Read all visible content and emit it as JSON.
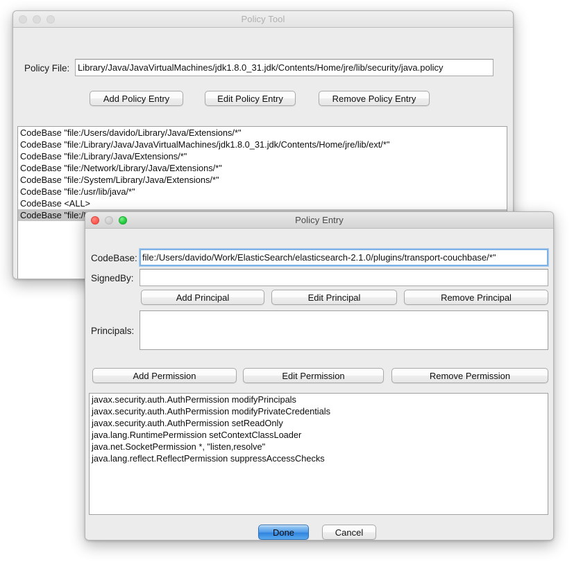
{
  "policy_tool": {
    "title": "Policy Tool",
    "window_state": "inactive",
    "policy_file_label": "Policy File:",
    "policy_file_value": "Library/Java/JavaVirtualMachines/jdk1.8.0_31.jdk/Contents/Home/jre/lib/security/java.policy",
    "buttons": {
      "add": "Add Policy Entry",
      "edit": "Edit Policy Entry",
      "remove": "Remove Policy Entry"
    },
    "entries": [
      {
        "text": "CodeBase \"file:/Users/davido/Library/Java/Extensions/*\"",
        "selected": false
      },
      {
        "text": "CodeBase \"file:/Library/Java/JavaVirtualMachines/jdk1.8.0_31.jdk/Contents/Home/jre/lib/ext/*\"",
        "selected": false
      },
      {
        "text": "CodeBase \"file:/Library/Java/Extensions/*\"",
        "selected": false
      },
      {
        "text": "CodeBase \"file:/Network/Library/Java/Extensions/*\"",
        "selected": false
      },
      {
        "text": "CodeBase \"file:/System/Library/Java/Extensions/*\"",
        "selected": false
      },
      {
        "text": "CodeBase \"file:/usr/lib/java/*\"",
        "selected": false
      },
      {
        "text": "CodeBase <ALL>",
        "selected": false
      },
      {
        "text": "CodeBase \"file:/Users/davido/Work/ElasticSearch/elasticsearch-2.1.0/plugins/transport-couchbase/*\"",
        "selected": true
      }
    ]
  },
  "policy_entry": {
    "title": "Policy Entry",
    "window_state": "active",
    "codebase_label": "CodeBase:",
    "codebase_value": "file:/Users/davido/Work/ElasticSearch/elasticsearch-2.1.0/plugins/transport-couchbase/*\"",
    "signedby_label": "SignedBy:",
    "signedby_value": "",
    "principal_buttons": {
      "add": "Add Principal",
      "edit": "Edit Principal",
      "remove": "Remove Principal"
    },
    "principals_label": "Principals:",
    "principals": [],
    "permission_buttons": {
      "add": "Add Permission",
      "edit": "Edit Permission",
      "remove": "Remove Permission"
    },
    "permissions": [
      "javax.security.auth.AuthPermission modifyPrincipals",
      "javax.security.auth.AuthPermission modifyPrivateCredentials",
      "javax.security.auth.AuthPermission setReadOnly",
      "java.lang.RuntimePermission setContextClassLoader",
      "java.net.SocketPermission *, \"listen,resolve\"",
      "java.lang.reflect.ReflectPermission suppressAccessChecks"
    ],
    "footer": {
      "done": "Done",
      "cancel": "Cancel"
    }
  },
  "colors": {
    "window_background": "#ececec",
    "list_background": "#ffffff",
    "selection": "#c6c6c6",
    "primary_button": "#4e9ae8",
    "focus_ring": "#7cb2e8",
    "traffic_close": "#ff5f57",
    "traffic_min": "#cfcfcf",
    "traffic_zoom": "#28cd41"
  }
}
